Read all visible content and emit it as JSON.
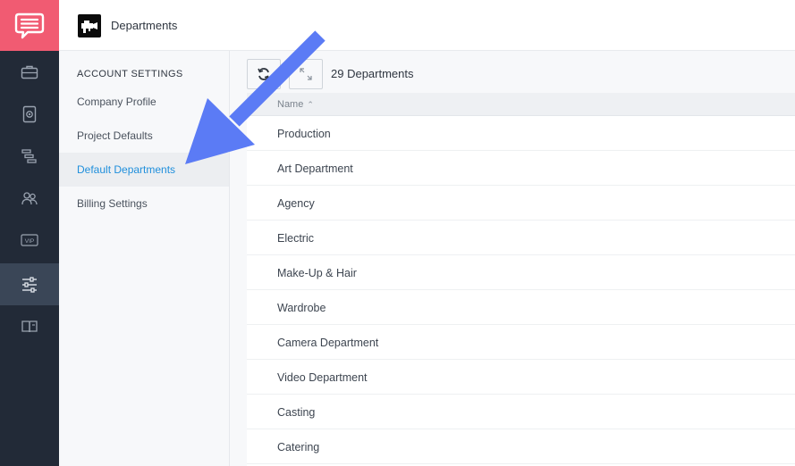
{
  "header": {
    "title": "Departments"
  },
  "rail": {
    "items": [
      {
        "icon": "briefcase-icon"
      },
      {
        "icon": "contacts-book-icon"
      },
      {
        "icon": "schedule-bars-icon"
      },
      {
        "icon": "people-icon"
      },
      {
        "icon": "vip-badge-icon"
      },
      {
        "icon": "sliders-settings-icon"
      },
      {
        "icon": "book-icon"
      }
    ],
    "active": "sliders-settings-icon"
  },
  "settings_menu": {
    "heading": "ACCOUNT SETTINGS",
    "items": [
      {
        "label": "Company Profile"
      },
      {
        "label": "Project Defaults"
      },
      {
        "label": "Default Departments"
      },
      {
        "label": "Billing Settings"
      }
    ],
    "active": "Default Departments"
  },
  "toolbar": {
    "refresh_icon": "refresh-icon",
    "expand_icon": "expand-icon",
    "count_label": "29 Departments"
  },
  "table": {
    "column_header": "Name",
    "sort": "ascending",
    "rows": [
      "Production",
      "Art Department",
      "Agency",
      "Electric",
      "Make-Up & Hair",
      "Wardrobe",
      "Camera Department",
      "Video Department",
      "Casting",
      "Catering"
    ]
  },
  "colors": {
    "brand": "#f15b72",
    "rail_bg": "#222a37",
    "active_link": "#1f8fdc",
    "arrow": "#5b7bf5"
  }
}
